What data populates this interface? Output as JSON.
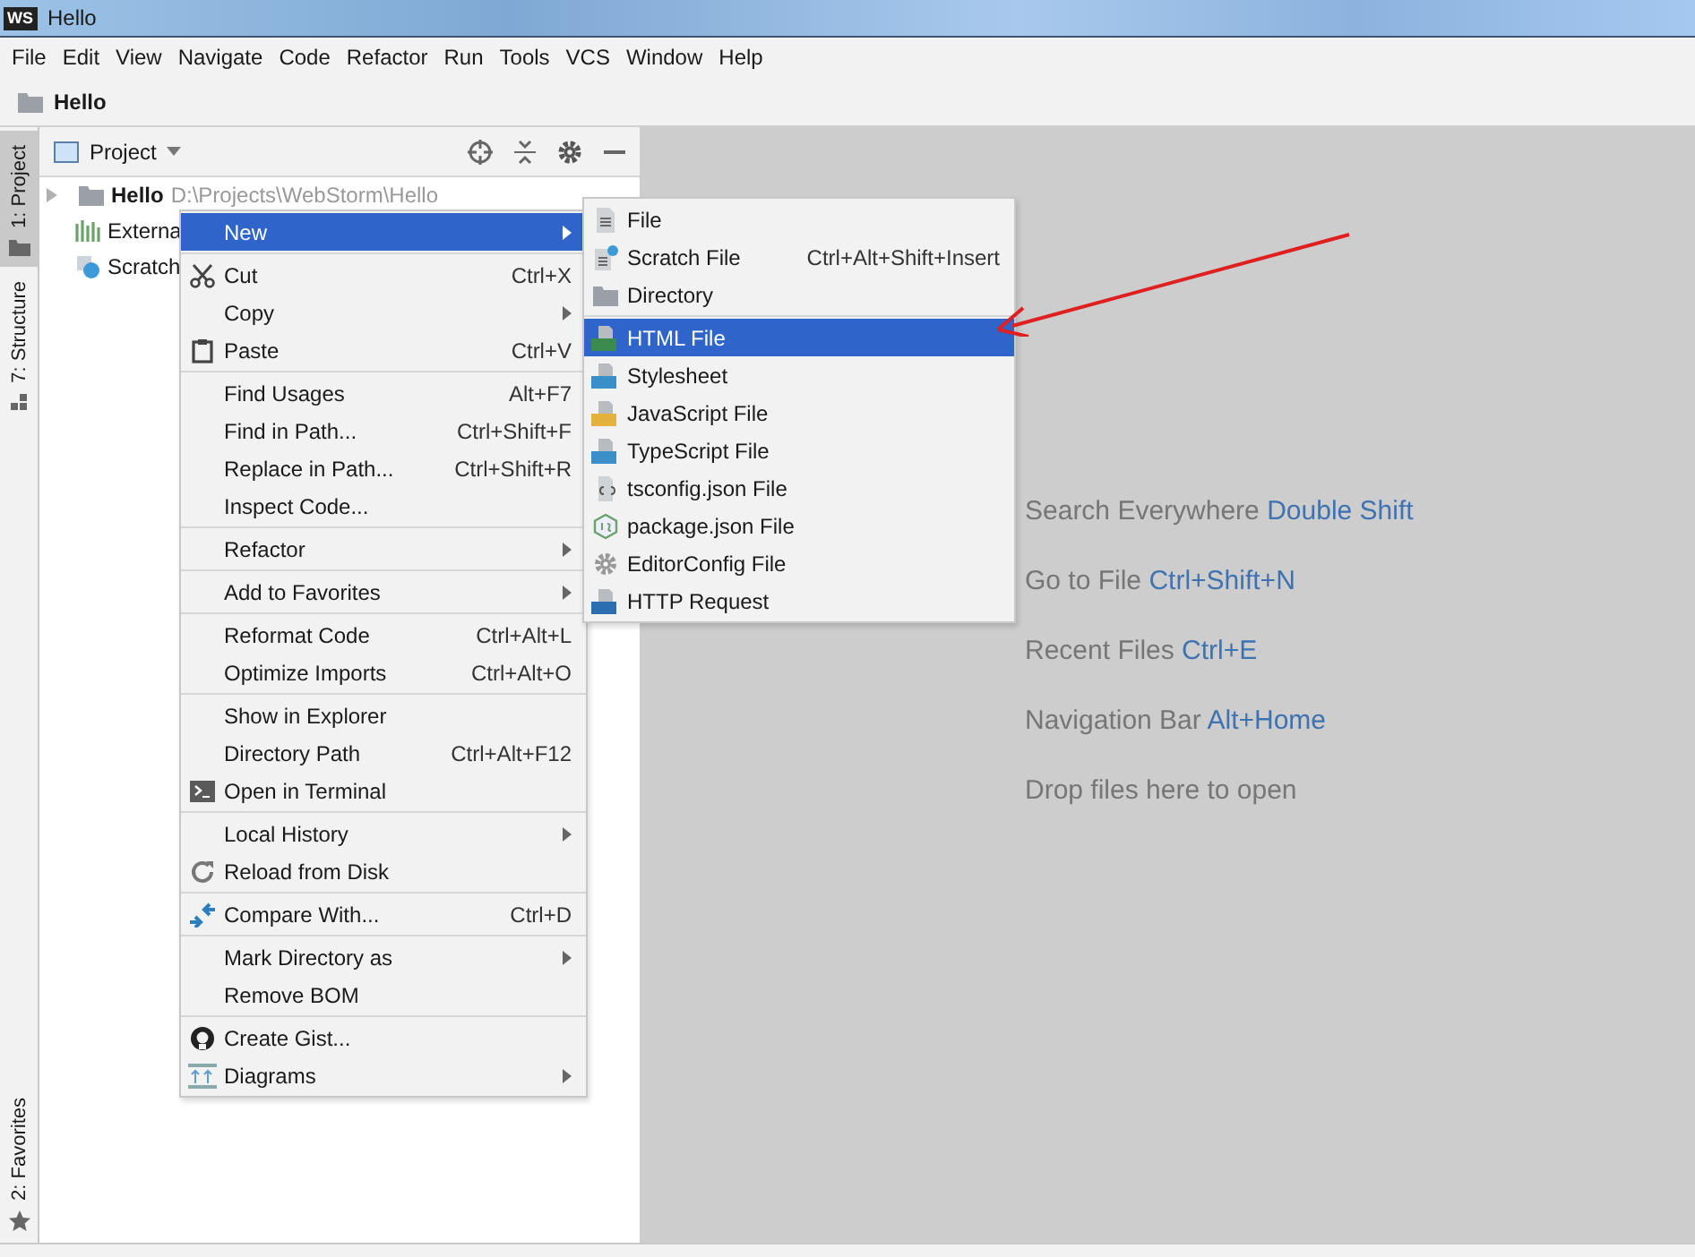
{
  "window": {
    "logo": "WS",
    "title": "Hello"
  },
  "menu_bar": [
    "File",
    "Edit",
    "View",
    "Navigate",
    "Code",
    "Refactor",
    "Run",
    "Tools",
    "VCS",
    "Window",
    "Help"
  ],
  "breadcrumb": "Hello",
  "tool_strip": {
    "top": [
      {
        "label": "1: Project",
        "selected": true
      },
      {
        "label": "7: Structure",
        "selected": false
      }
    ],
    "bottom": [
      {
        "label": "2: Favorites",
        "selected": false
      }
    ]
  },
  "project_panel": {
    "title": "Project",
    "tree": [
      {
        "label": "Hello",
        "path": "D:\\Projects\\WebStorm\\Hello",
        "expanded": false
      },
      {
        "label": "Externa"
      },
      {
        "label": "Scratch"
      }
    ]
  },
  "editor_hints": [
    {
      "text": "Search Everywhere",
      "shortcut": "Double Shift"
    },
    {
      "text": "Go to File",
      "shortcut": "Ctrl+Shift+N"
    },
    {
      "text": "Recent Files",
      "shortcut": "Ctrl+E"
    },
    {
      "text": "Navigation Bar",
      "shortcut": "Alt+Home"
    },
    {
      "text": "Drop files here to open"
    }
  ],
  "context_menu": {
    "groups": [
      [
        {
          "label": "New",
          "submenu": true,
          "selected": true
        }
      ],
      [
        {
          "label": "Cut",
          "shortcut": "Ctrl+X",
          "submenu": false,
          "selected": false
        },
        {
          "label": "Copy",
          "submenu": true,
          "selected": false
        },
        {
          "label": "Paste",
          "shortcut": "Ctrl+V",
          "submenu": false,
          "selected": false
        }
      ],
      [
        {
          "label": "Find Usages",
          "shortcut": "Alt+F7",
          "submenu": false,
          "selected": false
        },
        {
          "label": "Find in Path...",
          "shortcut": "Ctrl+Shift+F",
          "submenu": false,
          "selected": false
        },
        {
          "label": "Replace in Path...",
          "shortcut": "Ctrl+Shift+R",
          "submenu": false,
          "selected": false
        },
        {
          "label": "Inspect Code...",
          "submenu": false,
          "selected": false
        }
      ],
      [
        {
          "label": "Refactor",
          "submenu": true,
          "selected": false
        }
      ],
      [
        {
          "label": "Add to Favorites",
          "submenu": true,
          "selected": false
        }
      ],
      [
        {
          "label": "Reformat Code",
          "shortcut": "Ctrl+Alt+L",
          "submenu": false,
          "selected": false
        },
        {
          "label": "Optimize Imports",
          "shortcut": "Ctrl+Alt+O",
          "submenu": false,
          "selected": false
        }
      ],
      [
        {
          "label": "Show in Explorer",
          "submenu": false,
          "selected": false
        },
        {
          "label": "Directory Path",
          "shortcut": "Ctrl+Alt+F12",
          "submenu": false,
          "selected": false
        },
        {
          "label": "Open in Terminal",
          "submenu": false,
          "selected": false
        }
      ],
      [
        {
          "label": "Local History",
          "submenu": true,
          "selected": false
        },
        {
          "label": "Reload from Disk",
          "submenu": false,
          "selected": false
        }
      ],
      [
        {
          "label": "Compare With...",
          "shortcut": "Ctrl+D",
          "submenu": false,
          "selected": false
        }
      ],
      [
        {
          "label": "Mark Directory as",
          "submenu": true,
          "selected": false
        },
        {
          "label": "Remove BOM",
          "submenu": false,
          "selected": false
        }
      ],
      [
        {
          "label": "Create Gist...",
          "submenu": false,
          "selected": false
        },
        {
          "label": "Diagrams",
          "submenu": true,
          "selected": false
        }
      ]
    ]
  },
  "new_submenu": {
    "groups": [
      [
        {
          "label": "File",
          "submenu": false,
          "selected": false
        },
        {
          "label": "Scratch File",
          "shortcut": "Ctrl+Alt+Shift+Insert",
          "submenu": false,
          "selected": false
        },
        {
          "label": "Directory",
          "submenu": false,
          "selected": false
        }
      ],
      [
        {
          "label": "HTML File",
          "submenu": false,
          "selected": true
        },
        {
          "label": "Stylesheet",
          "submenu": false,
          "selected": false
        },
        {
          "label": "JavaScript File",
          "submenu": false,
          "selected": false
        },
        {
          "label": "TypeScript File",
          "submenu": false,
          "selected": false
        },
        {
          "label": "tsconfig.json File",
          "submenu": false,
          "selected": false
        },
        {
          "label": "package.json File",
          "submenu": false,
          "selected": false
        },
        {
          "label": "EditorConfig File",
          "submenu": false,
          "selected": false
        },
        {
          "label": "HTTP Request",
          "submenu": false,
          "selected": false
        }
      ]
    ]
  }
}
